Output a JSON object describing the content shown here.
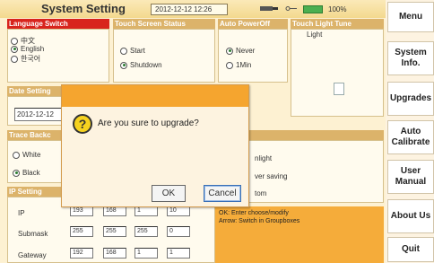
{
  "header": {
    "title": "System Setting",
    "datetime": "2012-12-12 12:26",
    "battery": "100%"
  },
  "sections": {
    "language": "Language Switch",
    "touch_status": "Touch Screen Status",
    "auto_power": "Auto PowerOff",
    "touch_tune": "Touch Light Tune",
    "date": "Date Setting",
    "trace": "Trace Backc",
    "ip": "IP Setting",
    "t_label": "t"
  },
  "language_options": [
    "中文",
    "English",
    "한국어"
  ],
  "touch_options": [
    "Start",
    "Shutdown"
  ],
  "power_options": [
    "Never",
    "1Min"
  ],
  "light_label": "Light",
  "date_value": "2012-12-12",
  "trace_options": [
    "White",
    "Black"
  ],
  "right_options": [
    "nlight",
    "ver saving",
    "tom"
  ],
  "ip": {
    "labels": [
      "IP",
      "Submask",
      "Gateway"
    ],
    "ip": [
      "193",
      "168",
      "1",
      "10"
    ],
    "submask": [
      "255",
      "255",
      "255",
      "0"
    ],
    "gateway": [
      "192",
      "168",
      "1",
      "1"
    ]
  },
  "help_text": {
    "line1": "OK: Enter choose/modify",
    "line2": "Arrow: Switch in Groupboxes"
  },
  "sidebar": {
    "menu": "Menu",
    "system_info": "System Info.",
    "upgrades": "Upgrades",
    "auto_calibrate": "Auto Calibrate",
    "user_manual": "User Manual",
    "about": "About Us",
    "quit": "Quit"
  },
  "dialog": {
    "message": "Are you sure to upgrade?",
    "ok": "OK",
    "cancel": "Cancel",
    "icon": "?"
  }
}
